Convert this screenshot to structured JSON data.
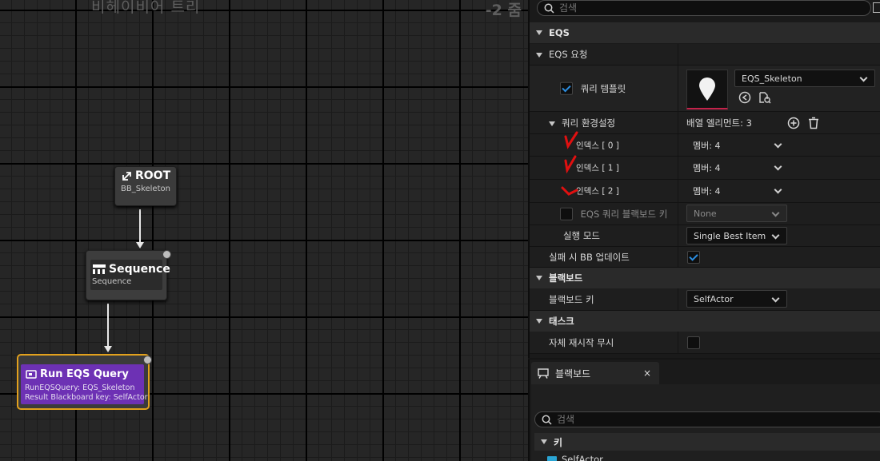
{
  "graph": {
    "title": "비헤이비어 트리",
    "zoom": "-2 줌",
    "nodes": {
      "root": {
        "title": "ROOT",
        "subtitle": "BB_Skeleton"
      },
      "sequence": {
        "title": "Sequence",
        "subtitle": "Sequence"
      },
      "run_eqs": {
        "title": "Run EQS Query",
        "line1": "RunEQSQuery: EQS_Skeleton",
        "line2": "Result Blackboard key: SelfActor",
        "accent": "#6d31b4",
        "selection_color": "#e2a11d"
      }
    }
  },
  "details": {
    "search_placeholder": "검색",
    "categories": {
      "eqs": "EQS",
      "eqs_request": "EQS 요청",
      "blackboard": "블랙보드",
      "task": "태스크"
    },
    "query_template": {
      "label": "쿼리 템플릿",
      "checked": true,
      "value": "EQS_Skeleton"
    },
    "query_config": {
      "label": "쿼리 환경설정",
      "array_label": "배열 엘리먼트: 3",
      "indices": [
        {
          "label": "인덱스 [ 0 ]",
          "value": "멤버: 4"
        },
        {
          "label": "인덱스 [ 1 ]",
          "value": "멤버: 4"
        },
        {
          "label": "인덱스 [ 2 ]",
          "value": "멤버: 4"
        }
      ]
    },
    "eqs_bb_key": {
      "label": "EQS 쿼리 블랙보드 키",
      "value": "None"
    },
    "run_mode": {
      "label": "실행 모드",
      "value": "Single Best Item"
    },
    "update_bb_on_fail": {
      "label": "실패 시 BB 업데이트",
      "checked": true
    },
    "blackboard_key": {
      "label": "블랙보드 키",
      "value": "SelfActor"
    },
    "ignore_restart_self": {
      "label": "자체 재시작 무시",
      "checked": false
    }
  },
  "blackboard_panel": {
    "tab_label": "블랙보드",
    "close": "×",
    "search_placeholder": "검색",
    "category": "키",
    "keys": [
      "SelfActor"
    ],
    "key_color": "#2aa5d4"
  },
  "colors": {
    "annotation_red": "#e01010",
    "checkbox_blue": "#2b8de0"
  }
}
